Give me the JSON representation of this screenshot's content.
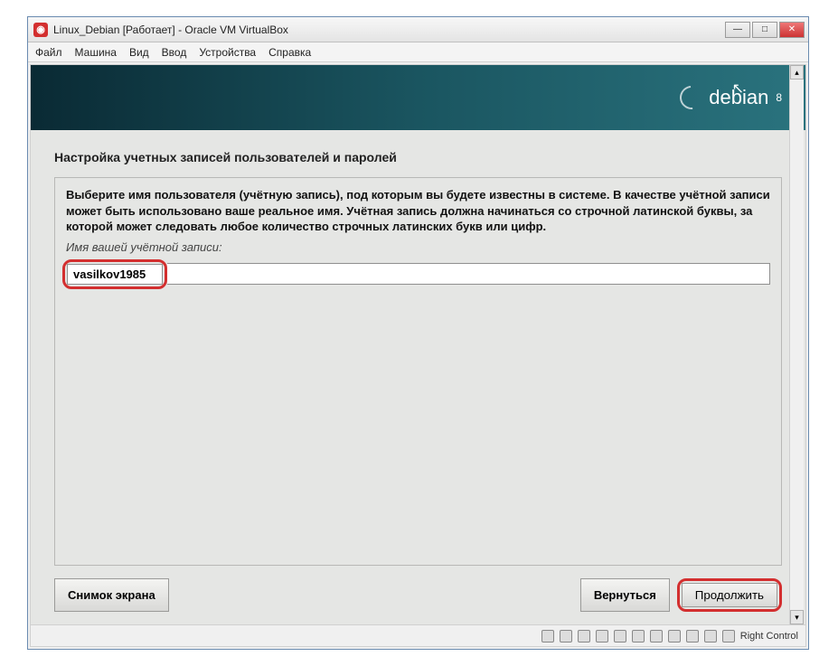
{
  "window": {
    "title": "Linux_Debian [Работает] - Oracle VM VirtualBox"
  },
  "menubar": {
    "items": [
      "Файл",
      "Машина",
      "Вид",
      "Ввод",
      "Устройства",
      "Справка"
    ]
  },
  "debian": {
    "name": "debian",
    "version": "8"
  },
  "installer": {
    "section_title": "Настройка учетных записей пользователей и паролей",
    "description": "Выберите имя пользователя (учётную запись), под которым вы будете известны в системе. В качестве учётной записи может быть использовано ваше реальное имя. Учётная запись должна начинаться со строчной латинской буквы, за которой может следовать любое количество строчных латинских букв или цифр.",
    "field_label": "Имя вашей учётной записи:",
    "username_value": "vasilkov1985",
    "buttons": {
      "screenshot": "Снимок экрана",
      "back": "Вернуться",
      "continue": "Продолжить"
    }
  },
  "statusbar": {
    "host_key": "Right Control"
  }
}
